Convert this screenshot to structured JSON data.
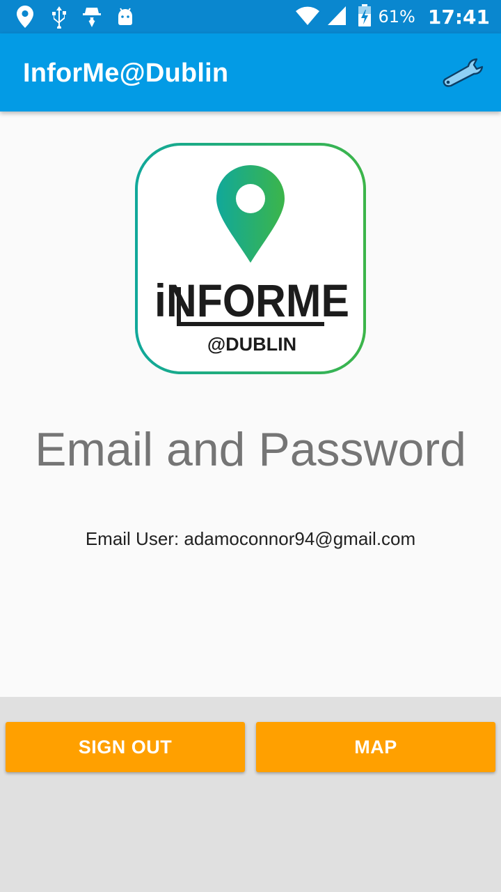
{
  "status_bar": {
    "icons": [
      "location-pin-icon",
      "usb-icon",
      "incognito-icon",
      "android-icon",
      "wifi-icon",
      "signal-icon",
      "battery-charging-icon"
    ],
    "battery": "61%",
    "time": "17:41"
  },
  "app_bar": {
    "title": "InforMe@Dublin",
    "settings_icon": "wrench-icon"
  },
  "logo": {
    "text": "iNFORME",
    "subtext": "@DUBLIN",
    "gradient_start": "#11a89a",
    "gradient_end": "#3cb54a"
  },
  "main": {
    "heading": "Email and Password",
    "email_line": "Email User: adamoconnor94@gmail.com"
  },
  "buttons": {
    "sign_out": "SIGN OUT",
    "map": "MAP"
  },
  "colors": {
    "status_bar": "#0a87cf",
    "app_bar": "#039be5",
    "button": "#ffa000",
    "bottom_area": "#e0e0e0"
  }
}
